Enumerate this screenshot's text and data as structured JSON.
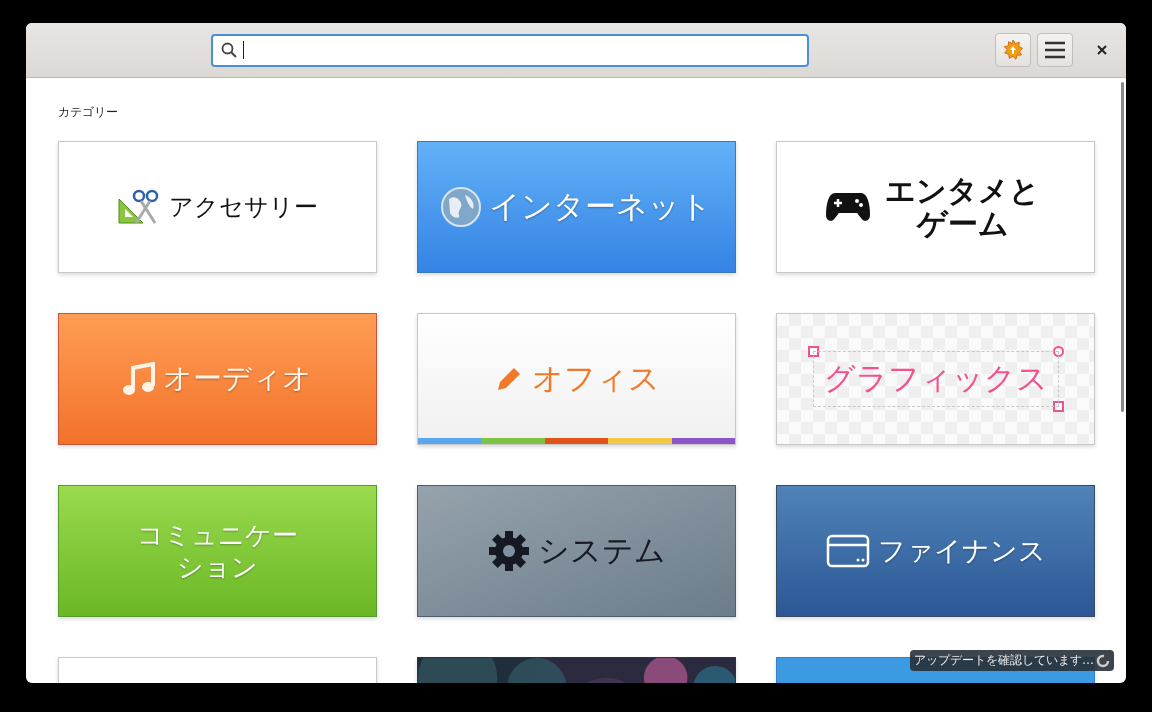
{
  "header": {
    "search": {
      "kind": "focused"
    }
  },
  "section_title": "カテゴリー",
  "tiles": [
    {
      "kind": "accessories",
      "label": "アクセサリー"
    },
    {
      "kind": "internet",
      "label": "インターネット"
    },
    {
      "kind": "games",
      "label": "エンタメとゲーム"
    },
    {
      "kind": "audio",
      "label": "オーディオ"
    },
    {
      "kind": "office",
      "label": "オフィス"
    },
    {
      "kind": "graphics",
      "label": "グラフィックス"
    },
    {
      "kind": "communication",
      "label": "コミュニケーション"
    },
    {
      "kind": "system",
      "label": "システム"
    },
    {
      "kind": "finance",
      "label": "ファイナンス"
    },
    {
      "kind": "plain"
    },
    {
      "kind": "picture"
    },
    {
      "kind": "blue"
    }
  ],
  "status": {
    "text": "アップデートを確認しています…"
  }
}
